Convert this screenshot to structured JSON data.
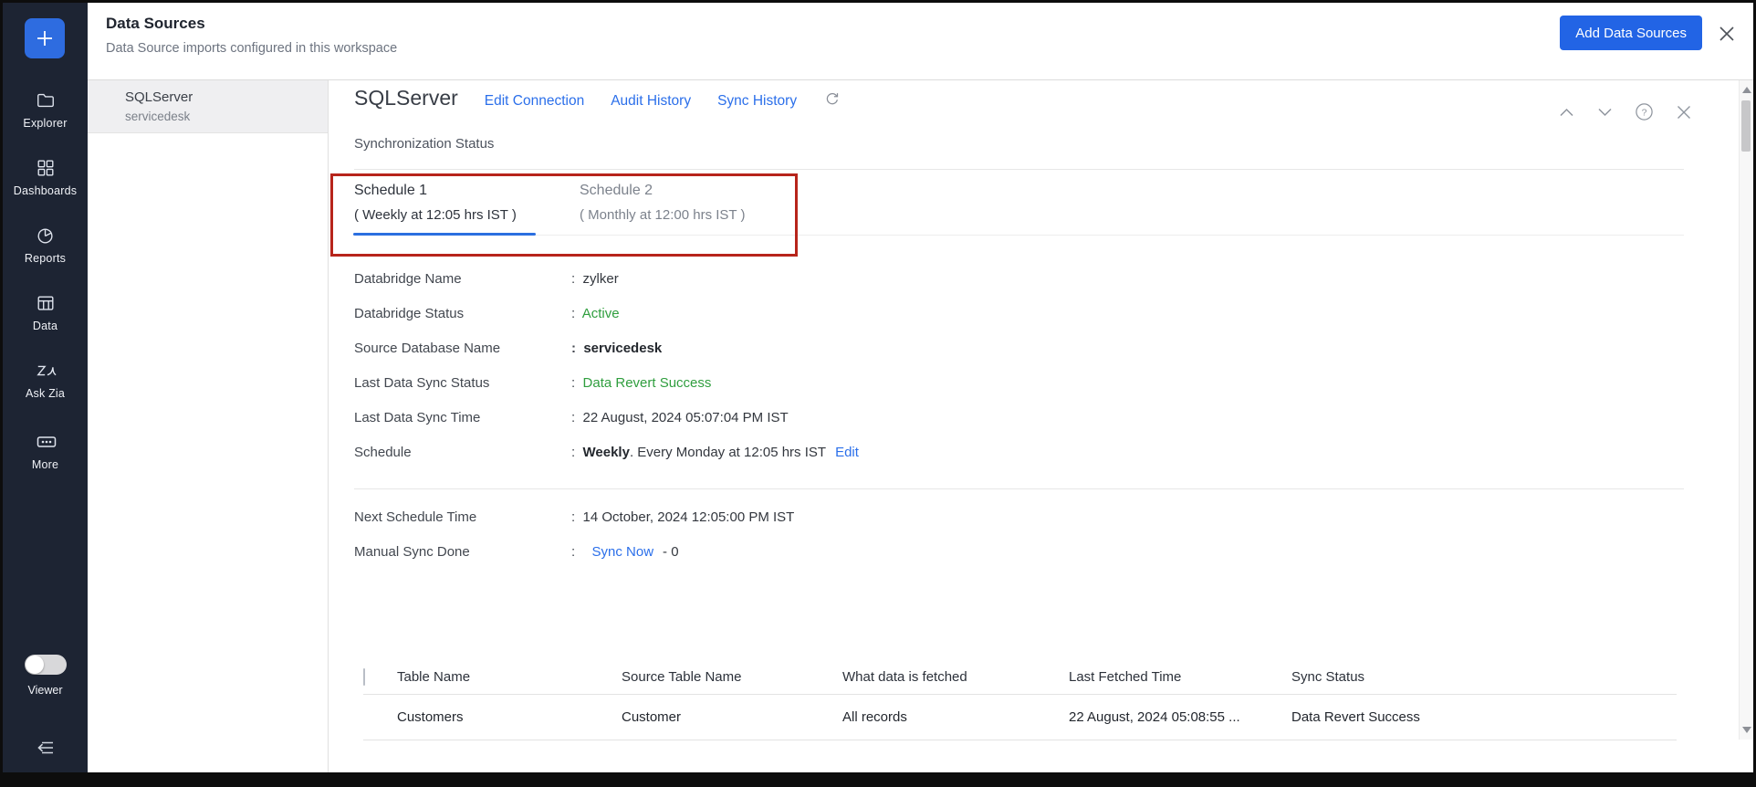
{
  "app": {
    "title": "Data Sources",
    "subtitle": "Data Source imports configured in this workspace",
    "add_button_label": "Add Data Sources"
  },
  "colors": {
    "accent_blue": "#2264e5",
    "link_blue": "#2b6fea",
    "status_green": "#2f9e3e",
    "annotation_red": "#b7241b",
    "sidebar_bg": "#1d2433"
  },
  "icons": {
    "sidebar": [
      "plus-icon",
      "folder-icon",
      "dashboards-icon",
      "pie-chart-icon",
      "table-icon",
      "zia-icon",
      "more-icon",
      "collapse-icon"
    ],
    "header": [
      "close-icon"
    ],
    "detail_toolbar": [
      "chevron-up-icon",
      "chevron-down-icon",
      "help-icon",
      "close-icon",
      "refresh-icon"
    ]
  },
  "sidebar": {
    "items": [
      {
        "label": "Explorer",
        "icon": "folder-icon"
      },
      {
        "label": "Dashboards",
        "icon": "dashboards-icon"
      },
      {
        "label": "Reports",
        "icon": "pie-chart-icon"
      },
      {
        "label": "Data",
        "icon": "table-icon"
      },
      {
        "label": "Ask Zia",
        "icon": "zia-icon"
      },
      {
        "label": "More",
        "icon": "more-icon"
      }
    ],
    "viewer_label": "Viewer"
  },
  "source_list": {
    "items": [
      {
        "name": "SQLServer",
        "database": "servicedesk",
        "selected": true
      }
    ]
  },
  "detail": {
    "title": "SQLServer",
    "links": [
      "Edit Connection",
      "Audit History",
      "Sync History"
    ],
    "section_title": "Synchronization Status",
    "tabs": [
      {
        "title": "Schedule 1",
        "subtitle": "( Weekly at 12:05 hrs IST )",
        "active": true
      },
      {
        "title": "Schedule 2",
        "subtitle": "( Monthly at 12:00 hrs IST )",
        "active": false
      }
    ],
    "fields": [
      {
        "label": "Databridge Name",
        "value": "zylker"
      },
      {
        "label": "Databridge Status",
        "value": "Active"
      },
      {
        "label": "Source Database Name",
        "value": "servicedesk"
      },
      {
        "label": "Last Data Sync Status",
        "value": "Data Revert Success"
      },
      {
        "label": "Last Data Sync Time",
        "value": "22 August, 2024 05:07:04 PM IST"
      },
      {
        "label": "Schedule",
        "value_bold": "Weekly",
        "value_rest": ". Every Monday at 12:05 hrs IST",
        "link": "Edit"
      }
    ],
    "fields2": [
      {
        "label": "Next Schedule Time",
        "value": "14 October, 2024 12:05:00 PM IST"
      },
      {
        "label": "Manual Sync Done",
        "link": "Sync Now",
        "suffix": "- 0"
      }
    ]
  },
  "table": {
    "columns": [
      "Table Name",
      "Source Table Name",
      "What data is fetched",
      "Last Fetched Time",
      "Sync Status"
    ],
    "rows": [
      [
        "Customers",
        "Customer",
        "All records",
        "22 August, 2024 05:08:55 ...",
        "Data Revert Success"
      ]
    ]
  }
}
